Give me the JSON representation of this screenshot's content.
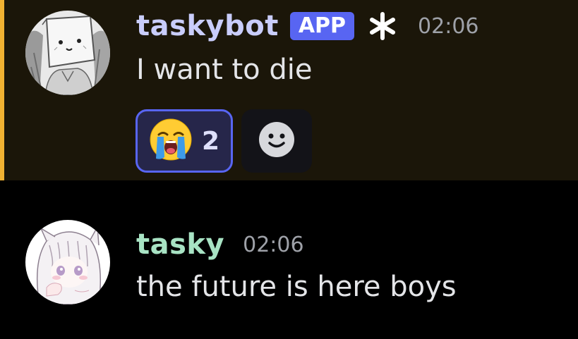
{
  "messages": [
    {
      "username": "taskybot",
      "badge": "APP",
      "timestamp": "02:06",
      "text": "I want to die",
      "highlight_color": "#f0b232",
      "reactions": [
        {
          "emoji": "loudly-crying-face",
          "count": "2",
          "active": true
        }
      ]
    },
    {
      "username": "tasky",
      "timestamp": "02:06",
      "text": "the future is here boys"
    }
  ],
  "colors": {
    "app_badge": "#5865f2",
    "bot_username": "#c9cdfb",
    "user_username": "#a8e3c4"
  }
}
